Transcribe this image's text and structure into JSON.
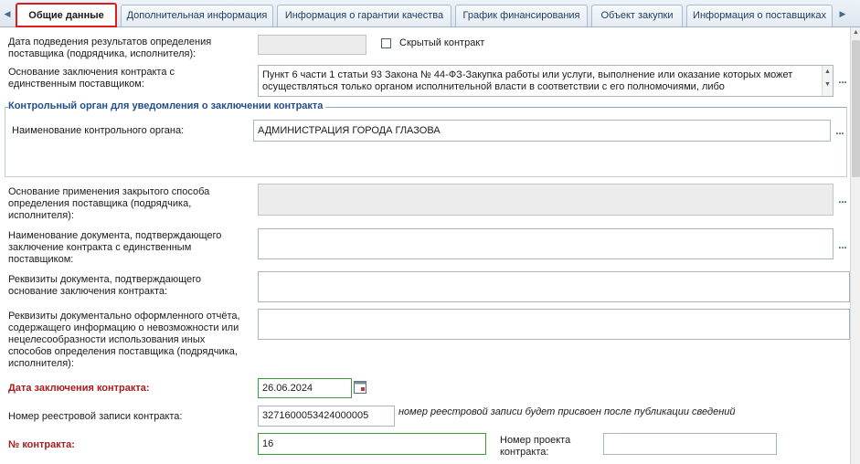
{
  "tabs": [
    {
      "label": "Общие данные",
      "active": true
    },
    {
      "label": "Дополнительная информация"
    },
    {
      "label": "Информация о гарантии качества"
    },
    {
      "label": "График финансирования"
    },
    {
      "label": "Объект закупки"
    },
    {
      "label": "Информация о поставщиках"
    }
  ],
  "form": {
    "results_date_label": "Дата подведения результатов определения поставщика (подрядчика, исполнителя):",
    "results_date_value": "",
    "hidden_contract_label": "Скрытый контракт",
    "single_supplier_basis_label": "Основание заключения контракта с единственным поставщиком:",
    "single_supplier_basis_value": "Пункт 6 части 1 статьи 93 Закона № 44-ФЗ-Закупка работы или услуги, выполнение или оказание которых может осуществляться только органом исполнительной власти в соответствии с его полномочиями, либо подведомственными ему государственным учреждением, государственным унитарным предприятием",
    "control_section_title": "Контрольный орган для уведомления о заключении контракта",
    "control_body_label": "Наименование контрольного органа:",
    "control_body_value": "АДМИНИСТРАЦИЯ ГОРОДА ГЛАЗОВА",
    "closed_method_label": "Основание применения закрытого способа определения поставщика (подрядчика, исполнителя):",
    "closed_method_value": "",
    "doc_name_label": "Наименование документа, подтверждающего заключение контракта с единственным поставщиком:",
    "doc_name_value": "",
    "doc_requisites_label": "Реквизиты документа, подтверждающего основание заключения контракта:",
    "doc_requisites_value": "",
    "impossibility_doc_label": "Реквизиты документально оформленного отчёта, содержащего информацию о невозможности или нецелесообразности использования иных способов определения поставщика (подрядчика, исполнителя):",
    "impossibility_doc_value": "",
    "contract_date_label": "Дата заключения контракта:",
    "contract_date_value": "26.06.2024",
    "registry_number_label": "Номер реестровой записи контракта:",
    "registry_number_value": "3271600053424000005",
    "registry_note": "номер реестровой записи будет присвоен после публикации сведений",
    "contract_number_label": "№ контракта:",
    "contract_number_value": "16",
    "project_number_label": "Номер проекта контракта:",
    "project_number_value": ""
  }
}
